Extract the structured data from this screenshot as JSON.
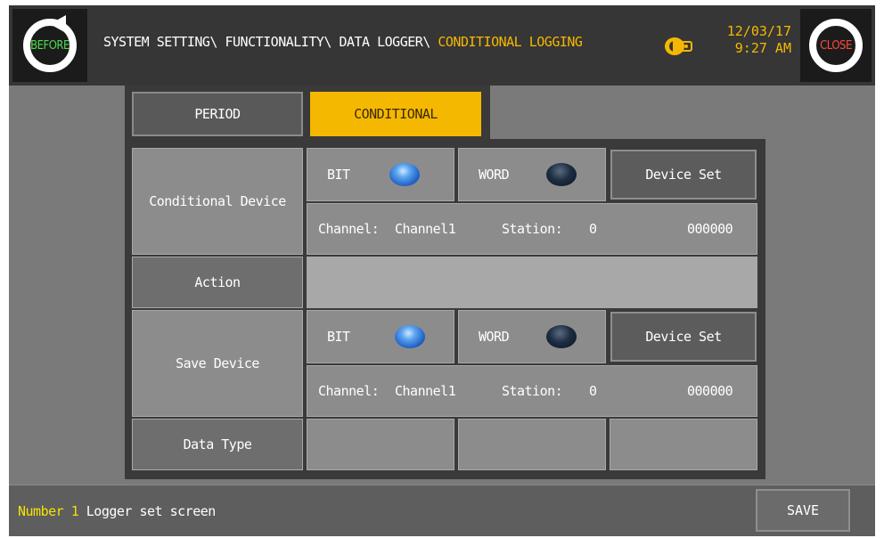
{
  "header": {
    "before_label": "BEFORE",
    "close_label": "CLOSE",
    "breadcrumb_path": "SYSTEM SETTING\\ FUNCTIONALITY\\ DATA LOGGER\\ ",
    "breadcrumb_current": "CONDITIONAL LOGGING",
    "date": "12/03/17",
    "time": "9:27 AM"
  },
  "tabs": {
    "period": "PERIOD",
    "conditional": "CONDITIONAL",
    "active": "CONDITIONAL"
  },
  "conditional_device": {
    "label": "Conditional Device",
    "bit_label": "BIT",
    "bit_selected": true,
    "word_label": "WORD",
    "word_selected": false,
    "device_set_label": "Device Set",
    "channel_label": "Channel:",
    "channel_value": "Channel1",
    "station_label": "Station:",
    "station_value": "0",
    "address": "000000"
  },
  "action": {
    "label": "Action",
    "value": ""
  },
  "save_device": {
    "label": "Save Device",
    "bit_label": "BIT",
    "bit_selected": true,
    "word_label": "WORD",
    "word_selected": false,
    "device_set_label": "Device Set",
    "channel_label": "Channel:",
    "channel_value": "Channel1",
    "station_label": "Station:",
    "station_value": "0",
    "address": "000000"
  },
  "data_type": {
    "label": "Data Type",
    "values": [
      "",
      "",
      ""
    ]
  },
  "footer": {
    "status_number": "Number 1",
    "status_text": "Logger set screen",
    "save_label": "SAVE"
  },
  "colors": {
    "accent": "#f5b800",
    "before_text": "#4ddd4d",
    "close_text": "#ff4a3a",
    "status_number": "#f5e400"
  }
}
